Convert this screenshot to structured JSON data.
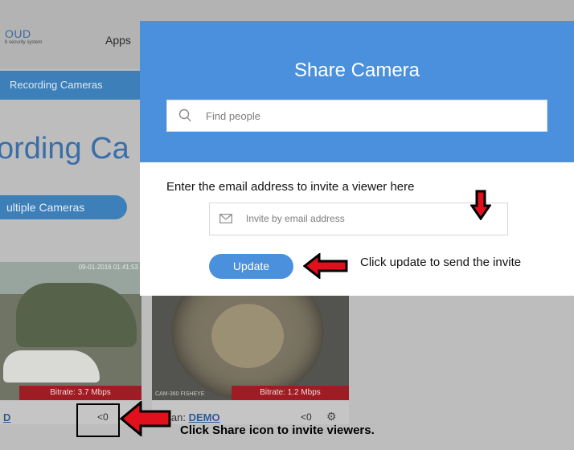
{
  "background": {
    "logo_text": "OUD",
    "logo_sub": "b security system",
    "apps_label": "Apps",
    "nav_bar_label": "Recording Cameras",
    "page_title": "ording Ca",
    "multiple_cameras_label": "ultiple Cameras",
    "camera1": {
      "timestamp": "09-01-2016 01:41:53",
      "bitrate": "Bitrate: 3.7 Mbps",
      "name_link": "D",
      "share_count": "0"
    },
    "camera2": {
      "watermark": "CAM-360 FISHEYE",
      "bitrate": "Bitrate: 1.2 Mbps",
      "plan_label": "lan:",
      "plan_link": "DEMO",
      "share_count": "0"
    }
  },
  "modal": {
    "title": "Share Camera",
    "search_placeholder": "Find people",
    "instruction": "Enter the email address to invite a viewer here",
    "email_placeholder": "Invite by email address",
    "update_label": "Update"
  },
  "annotations": {
    "update_hint": "Click update to send the invite",
    "share_hint": "Click Share icon to invite viewers.",
    "arrow_color": "#e0101c"
  },
  "colors": {
    "modal_header": "#4a90dc",
    "overlay": "#bdbdbd",
    "bitrate_bg": "#a01c24"
  }
}
